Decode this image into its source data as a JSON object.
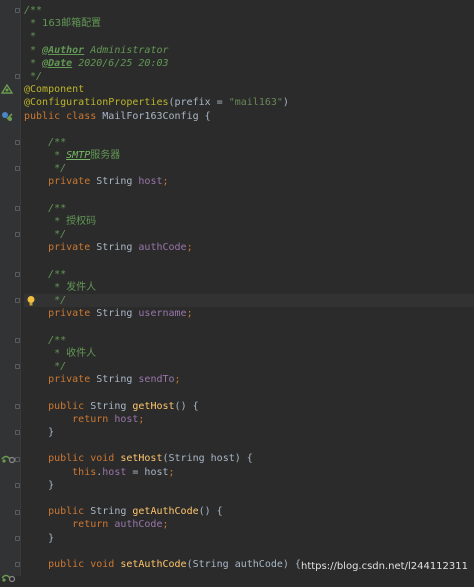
{
  "editor": {
    "lines": [
      [
        {
          "t": "/**",
          "c": "doc"
        }
      ],
      [
        {
          "t": " * ",
          "c": "doc"
        },
        {
          "t": "163邮箱配置",
          "c": "cn"
        }
      ],
      [
        {
          "t": " *",
          "c": "doc"
        }
      ],
      [
        {
          "t": " * ",
          "c": "doc"
        },
        {
          "t": "@Author",
          "c": "doctag"
        },
        {
          "t": " Administrator",
          "c": "doc"
        }
      ],
      [
        {
          "t": " * ",
          "c": "doc"
        },
        {
          "t": "@Date",
          "c": "doctag"
        },
        {
          "t": " 2020/6/25 20:03",
          "c": "doc"
        }
      ],
      [
        {
          "t": " */",
          "c": "doc"
        }
      ],
      [
        {
          "t": "@Component",
          "c": "ann"
        }
      ],
      [
        {
          "t": "@ConfigurationProperties",
          "c": "ann"
        },
        {
          "t": "(prefix = ",
          "c": "plain"
        },
        {
          "t": "\"mail163\"",
          "c": "str"
        },
        {
          "t": ")",
          "c": "plain"
        }
      ],
      [
        {
          "t": "public class ",
          "c": "kw"
        },
        {
          "t": "MailFor163Config {",
          "c": "plain"
        }
      ],
      [],
      [
        {
          "t": "    /**",
          "c": "doc"
        }
      ],
      [
        {
          "t": "     * ",
          "c": "doc"
        },
        {
          "t": "SMTP",
          "c": "doctag2"
        },
        {
          "t": "服务器",
          "c": "cn"
        }
      ],
      [
        {
          "t": "     */",
          "c": "doc"
        }
      ],
      [
        {
          "t": "    private ",
          "c": "kw"
        },
        {
          "t": "String ",
          "c": "plain"
        },
        {
          "t": "host",
          "c": "field"
        },
        {
          "t": ";",
          "c": "kw"
        }
      ],
      [],
      [
        {
          "t": "    /**",
          "c": "doc"
        }
      ],
      [
        {
          "t": "     * ",
          "c": "doc"
        },
        {
          "t": "授权码",
          "c": "cn"
        }
      ],
      [
        {
          "t": "     */",
          "c": "doc"
        }
      ],
      [
        {
          "t": "    private ",
          "c": "kw"
        },
        {
          "t": "String ",
          "c": "plain"
        },
        {
          "t": "authCode",
          "c": "field"
        },
        {
          "t": ";",
          "c": "kw"
        }
      ],
      [],
      [
        {
          "t": "    /**",
          "c": "doc"
        }
      ],
      [
        {
          "t": "     * ",
          "c": "doc"
        },
        {
          "t": "发件人",
          "c": "cn"
        }
      ],
      [
        {
          "t": "     */",
          "c": "doc"
        }
      ],
      [
        {
          "t": "    private ",
          "c": "kw"
        },
        {
          "t": "String ",
          "c": "plain"
        },
        {
          "t": "username",
          "c": "field"
        },
        {
          "t": ";",
          "c": "kw"
        }
      ],
      [],
      [
        {
          "t": "    /**",
          "c": "doc"
        }
      ],
      [
        {
          "t": "     * ",
          "c": "doc"
        },
        {
          "t": "收件人",
          "c": "cn"
        }
      ],
      [
        {
          "t": "     */",
          "c": "doc"
        }
      ],
      [
        {
          "t": "    private ",
          "c": "kw"
        },
        {
          "t": "String ",
          "c": "plain"
        },
        {
          "t": "sendTo",
          "c": "field"
        },
        {
          "t": ";",
          "c": "kw"
        }
      ],
      [],
      [
        {
          "t": "    public ",
          "c": "kw"
        },
        {
          "t": "String ",
          "c": "plain"
        },
        {
          "t": "getHost",
          "c": "method"
        },
        {
          "t": "() {",
          "c": "plain"
        }
      ],
      [
        {
          "t": "        return ",
          "c": "kw"
        },
        {
          "t": "host",
          "c": "field"
        },
        {
          "t": ";",
          "c": "kw"
        }
      ],
      [
        {
          "t": "    }",
          "c": "plain"
        }
      ],
      [],
      [
        {
          "t": "    public void ",
          "c": "kw"
        },
        {
          "t": "setHost",
          "c": "method"
        },
        {
          "t": "(String host) {",
          "c": "plain"
        }
      ],
      [
        {
          "t": "        this",
          "c": "kw"
        },
        {
          "t": ".",
          "c": "plain"
        },
        {
          "t": "host",
          "c": "field"
        },
        {
          "t": " = host",
          "c": "plain"
        },
        {
          "t": ";",
          "c": "kw"
        }
      ],
      [
        {
          "t": "    }",
          "c": "plain"
        }
      ],
      [],
      [
        {
          "t": "    public ",
          "c": "kw"
        },
        {
          "t": "String ",
          "c": "plain"
        },
        {
          "t": "getAuthCode",
          "c": "method"
        },
        {
          "t": "() {",
          "c": "plain"
        }
      ],
      [
        {
          "t": "        return ",
          "c": "kw"
        },
        {
          "t": "authCode",
          "c": "field"
        },
        {
          "t": ";",
          "c": "kw"
        }
      ],
      [
        {
          "t": "    }",
          "c": "plain"
        }
      ],
      [],
      [
        {
          "t": "    public void ",
          "c": "kw"
        },
        {
          "t": "setAuthCode",
          "c": "method"
        },
        {
          "t": "(String authCode) {",
          "c": "plain"
        }
      ]
    ],
    "highlighted_line": 22
  },
  "watermark": "https://blog.csdn.net/l244112311",
  "colors": {
    "background": "#2b2b2b",
    "gutter": "#313335",
    "keyword": "#cc7832",
    "annotation": "#bbb529",
    "field": "#9876aa",
    "string": "#6a8759",
    "method": "#ffc66d",
    "doc_comment": "#629755",
    "plain": "#a9b7c6"
  },
  "gutter_icons": [
    {
      "line": 6,
      "icon": "spring-bean-icon"
    },
    {
      "line": 8,
      "icon": "spring-config-icon"
    },
    {
      "line": 22,
      "icon": "lightbulb-icon"
    },
    {
      "line": 34,
      "icon": "spring-property-icon"
    },
    {
      "line": 43,
      "icon": "spring-property-icon"
    }
  ]
}
